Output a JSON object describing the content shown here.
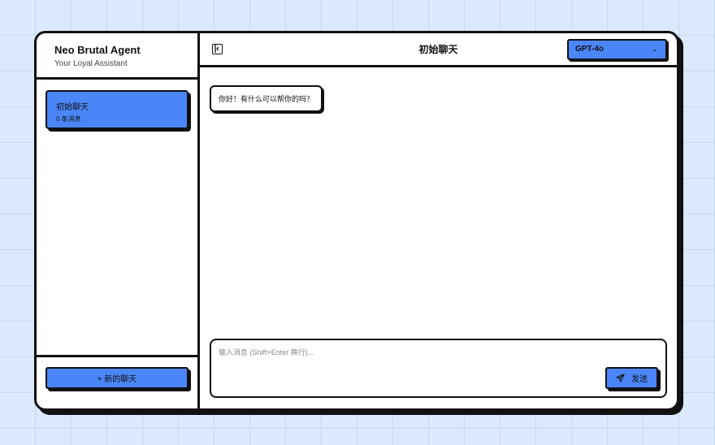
{
  "brand": {
    "title": "Neo Brutal Agent",
    "subtitle": "Your Loyal Assistant"
  },
  "conversations": [
    {
      "name": "初始聊天",
      "count": "0 条消息"
    }
  ],
  "sidebar": {
    "new_chat_label": "+ 新的聊天"
  },
  "header": {
    "title": "初始聊天",
    "panel_icon": "panel-collapse-icon",
    "model": {
      "selected": "GPT-4o",
      "icon": "chevron-down-icon"
    }
  },
  "messages": [
    {
      "role": "assistant",
      "text": "你好！有什么可以帮你的吗？"
    }
  ],
  "composer": {
    "placeholder": "输入消息 (Shift+Enter 换行)...",
    "value": "",
    "send_label": "发送",
    "send_icon": "send-icon"
  },
  "colors": {
    "accent": "#4a86f7",
    "border": "#111111",
    "background": "#dce8fb"
  }
}
